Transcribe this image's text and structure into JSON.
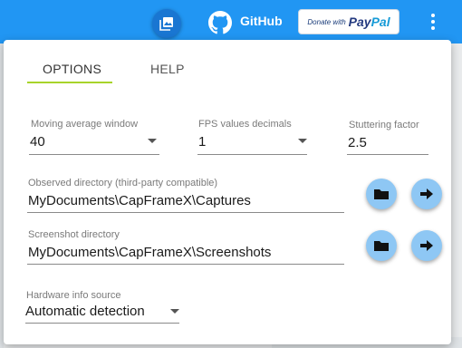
{
  "header": {
    "github_label": "GitHub",
    "paypal": {
      "prefix": "Donate with",
      "brand_a": "Pay",
      "brand_b": "Pal"
    },
    "icons": [
      "image-gallery-icon",
      "github-icon",
      "more-vert-icon"
    ],
    "colors": {
      "appbar": "#2196f3",
      "accent_tab": "#a8d42a",
      "fab": "#8ec7f4"
    }
  },
  "tabs": [
    {
      "label": "OPTIONS",
      "active": true
    },
    {
      "label": "HELP",
      "active": false
    }
  ],
  "options": {
    "moving_average": {
      "label": "Moving average window",
      "value": "40"
    },
    "fps_decimals": {
      "label": "FPS values decimals",
      "value": "1"
    },
    "stuttering": {
      "label": "Stuttering factor",
      "value": "2.5"
    },
    "observed_dir": {
      "label": "Observed directory (third-party compatible)",
      "value": "MyDocuments\\CapFrameX\\Captures"
    },
    "screenshot_dir": {
      "label": "Screenshot directory",
      "value": "MyDocuments\\CapFrameX\\Screenshots"
    },
    "hardware_source": {
      "label": "Hardware info source",
      "value": "Automatic detection"
    }
  }
}
